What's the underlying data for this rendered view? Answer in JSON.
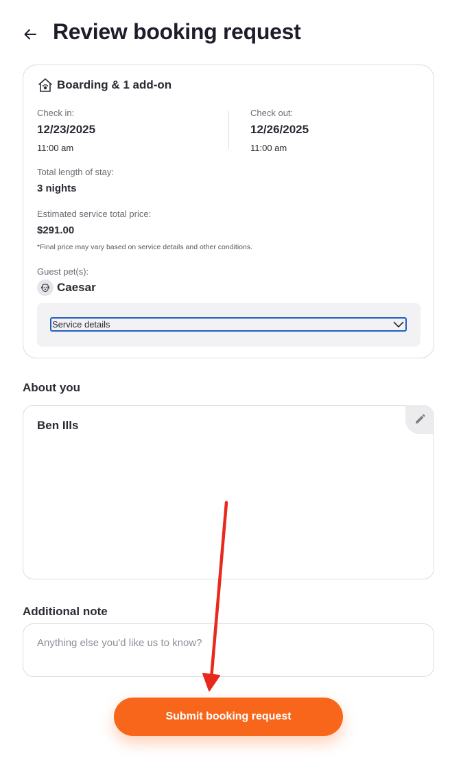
{
  "header": {
    "title": "Review booking request",
    "back_icon": "arrow-left-icon"
  },
  "booking": {
    "service_title": "Boarding & 1 add-on",
    "service_icon": "house-paw-icon",
    "check_in_label": "Check in:",
    "check_in_date": "12/23/2025",
    "check_in_time": "11:00 am",
    "check_out_label": "Check out:",
    "check_out_date": "12/26/2025",
    "check_out_time": "11:00 am",
    "stay_label": "Total length of stay:",
    "stay_value": "3 nights",
    "price_label": "Estimated service total price:",
    "price_value": "$291.00",
    "price_note": "*Final price may vary based on service details and other conditions.",
    "pets_label": "Guest pet(s):",
    "pet_name": "Caesar",
    "pet_icon": "dog-face-icon",
    "service_details_label": "Service details"
  },
  "about": {
    "heading": "About you",
    "name": "Ben Ills",
    "edit_icon": "pencil-icon"
  },
  "additional_note": {
    "heading": "Additional note",
    "placeholder": "Anything else you'd like us to know?",
    "value": ""
  },
  "submit": {
    "label": "Submit booking request"
  },
  "colors": {
    "accent": "#f7661a",
    "annotation_arrow": "#e8291c",
    "focus_outline": "#1f5fbf"
  }
}
